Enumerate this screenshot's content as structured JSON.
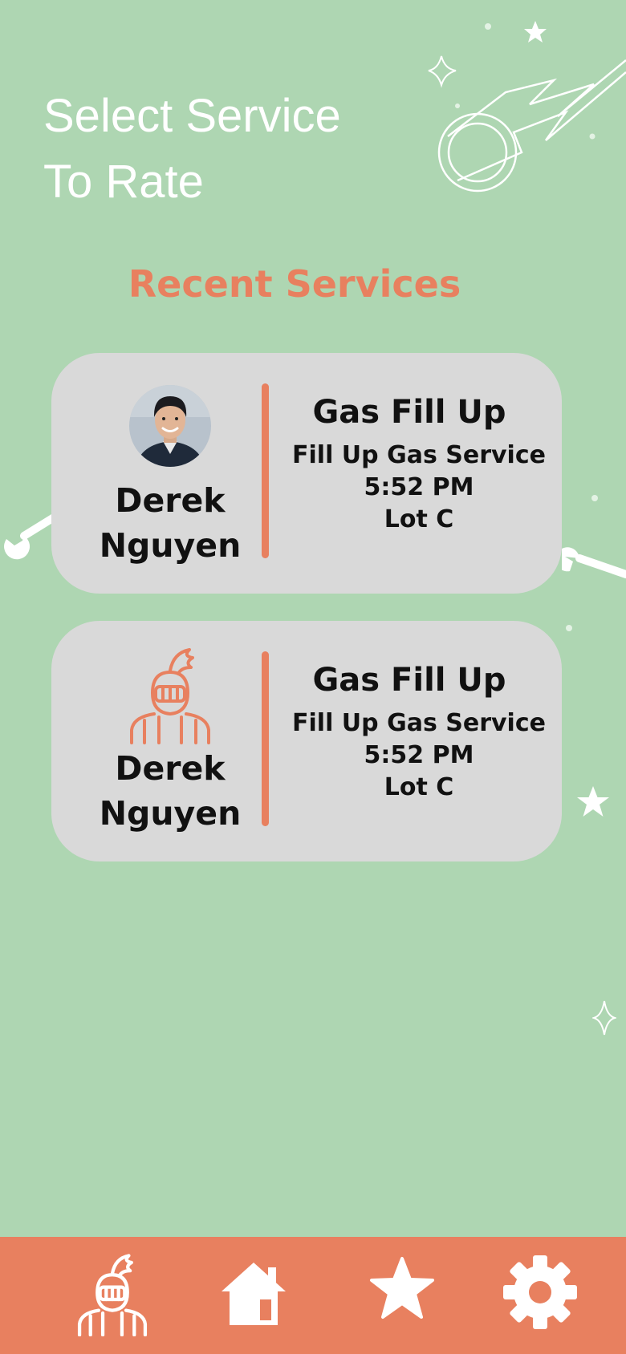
{
  "header": {
    "title_line1": "Select Service",
    "title_line2": "To Rate"
  },
  "section": {
    "title": "Recent Services"
  },
  "services": [
    {
      "provider_first": "Derek",
      "provider_last": "Nguyen",
      "avatar": "photo",
      "title": "Gas Fill Up",
      "description": "Fill Up Gas Service",
      "time": "5:52 PM",
      "location": "Lot C"
    },
    {
      "provider_first": "Derek",
      "provider_last": "Nguyen",
      "avatar": "knight-icon",
      "title": "Gas Fill Up",
      "description": "Fill Up Gas Service",
      "time": "5:52 PM",
      "location": "Lot C"
    }
  ],
  "nav": {
    "items": [
      "knight-icon",
      "home-icon",
      "star-icon",
      "gear-icon"
    ]
  },
  "colors": {
    "background": "#aed6b2",
    "accent": "#e8805f",
    "card": "#d9d9d9"
  }
}
